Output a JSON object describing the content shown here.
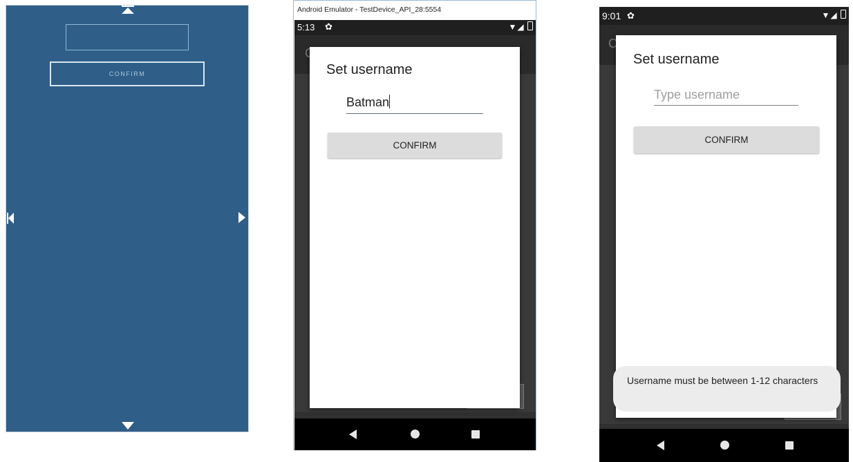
{
  "designer": {
    "confirm_label": "CONFIRM"
  },
  "emulator": {
    "window_title": "Android Emulator - TestDevice_API_28:5554",
    "status": {
      "time": "5:13",
      "settings_icon": "gear-icon"
    },
    "dialog": {
      "title": "Set username",
      "username_value": "Batman",
      "confirm_label": "CONFIRM"
    },
    "ghost_letter": "C"
  },
  "device": {
    "status": {
      "time": "9:01",
      "settings_icon": "gear-icon"
    },
    "dialog": {
      "title": "Set username",
      "username_placeholder": "Type username",
      "confirm_label": "CONFIRM"
    },
    "toast": "Username must be between 1-12 characters",
    "ghost_letter": "C"
  },
  "icons": [
    "arrow-up-icon",
    "arrow-down-icon",
    "arrow-left-icon",
    "arrow-right-icon",
    "wifi-icon",
    "signal-icon",
    "battery-icon",
    "nav-back-icon",
    "nav-home-icon",
    "nav-recents-icon"
  ]
}
